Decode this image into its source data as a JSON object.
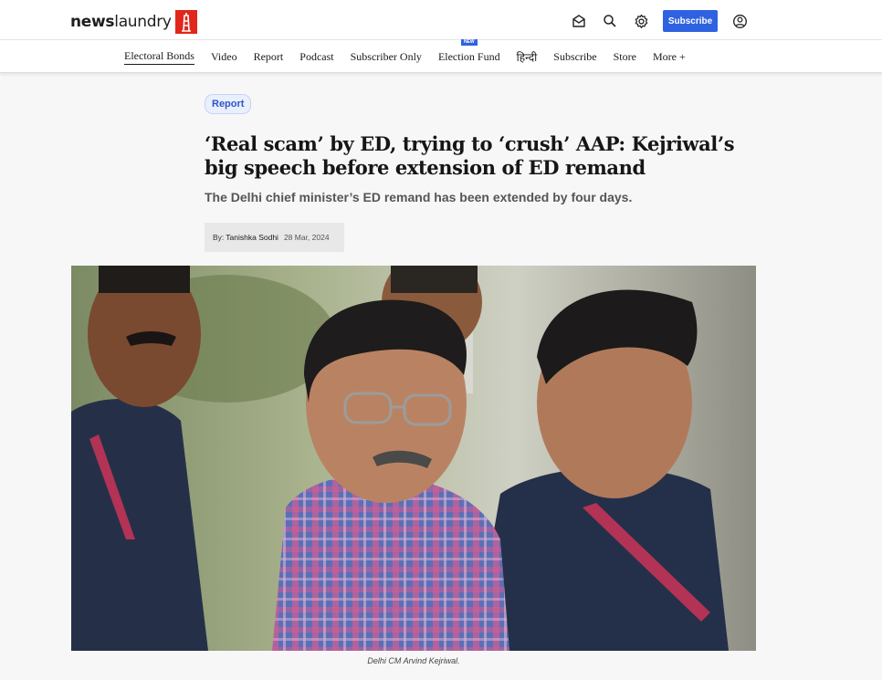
{
  "brand": {
    "logo_word": "news",
    "logo_word_2": "laundry"
  },
  "header": {
    "subscribe_label": "Subscribe"
  },
  "nav": {
    "items": [
      {
        "label": "Electoral Bonds"
      },
      {
        "label": "Video"
      },
      {
        "label": "Report"
      },
      {
        "label": "Podcast"
      },
      {
        "label": "Subscriber Only"
      },
      {
        "label": "Election Fund",
        "badge": "NEW"
      },
      {
        "label": "हिन्दी"
      },
      {
        "label": "Subscribe"
      },
      {
        "label": "Store"
      },
      {
        "label": "More +"
      }
    ]
  },
  "article": {
    "tag": "Report",
    "headline": "‘Real scam’ by ED, trying to ‘crush’ AAP: Kejriwal’s big speech before extension of ED remand",
    "subheadline": "The Delhi chief minister’s ED remand has been extended by four days.",
    "byline_prefix": "By:",
    "author": "Tanishka Sodhi",
    "date": "28 Mar, 2024",
    "image_caption": "Delhi CM Arvind Kejriwal."
  },
  "colors": {
    "accent_blue": "#2f62e0",
    "logo_red": "#e1261c",
    "tag_bg": "#e9effd"
  },
  "icons": [
    "newsletter-icon",
    "search-icon",
    "settings-icon",
    "account-icon",
    "logo-tower-icon"
  ]
}
